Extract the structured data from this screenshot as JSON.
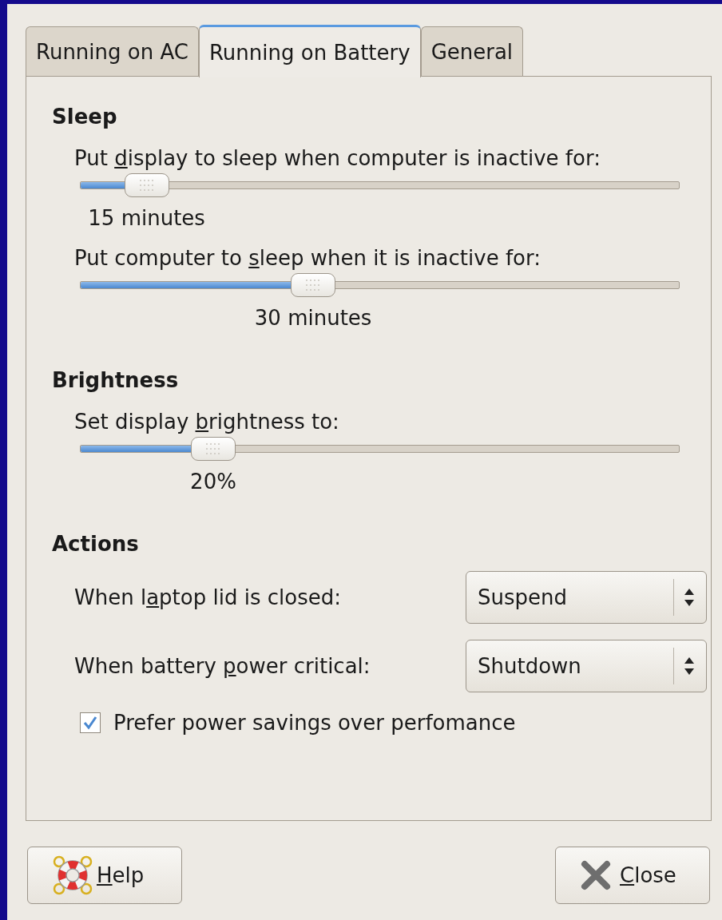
{
  "tabs": [
    {
      "label": "Running on AC",
      "selected": false
    },
    {
      "label": "Running on Battery",
      "selected": true
    },
    {
      "label": "General",
      "selected": false
    }
  ],
  "sections": [
    {
      "heading": "Sleep",
      "items": [
        {
          "kind": "slider",
          "label": [
            {
              "text": "Put ",
              "underline": false
            },
            {
              "text": "d",
              "underline": true
            },
            {
              "text": "isplay to sleep when computer is inactive for:",
              "underline": false
            }
          ],
          "level": 0.08,
          "reading": "15 minutes"
        },
        {
          "kind": "slider",
          "label": [
            {
              "text": "Put computer to ",
              "underline": false
            },
            {
              "text": "s",
              "underline": true
            },
            {
              "text": "leep when it is inactive for:",
              "underline": false
            }
          ],
          "level": 0.38,
          "reading": "30 minutes"
        }
      ]
    },
    {
      "heading": "Brightness",
      "items": [
        {
          "kind": "slider",
          "label": [
            {
              "text": "Set display ",
              "underline": false
            },
            {
              "text": "b",
              "underline": true
            },
            {
              "text": "rightness to:",
              "underline": false
            }
          ],
          "level": 0.2,
          "reading": "20%"
        }
      ]
    },
    {
      "heading": "Actions",
      "items": [
        {
          "kind": "combo",
          "label": [
            {
              "text": "When l",
              "underline": false
            },
            {
              "text": "a",
              "underline": true
            },
            {
              "text": "ptop lid is closed:",
              "underline": false
            }
          ],
          "value": "Suspend"
        },
        {
          "kind": "combo",
          "label": [
            {
              "text": "When battery ",
              "underline": false
            },
            {
              "text": "p",
              "underline": true
            },
            {
              "text": "ower critical:",
              "underline": false
            }
          ],
          "value": "Shutdown"
        },
        {
          "kind": "checkbox",
          "text": "Prefer power savings over perfomance",
          "checked": true
        }
      ]
    }
  ],
  "buttons": [
    {
      "kind": "help",
      "label": [
        {
          "text": "H",
          "underline": true
        },
        {
          "text": "elp",
          "underline": false
        }
      ]
    },
    {
      "kind": "close",
      "label": [
        {
          "text": "C",
          "underline": true
        },
        {
          "text": "lose",
          "underline": false
        }
      ]
    }
  ]
}
